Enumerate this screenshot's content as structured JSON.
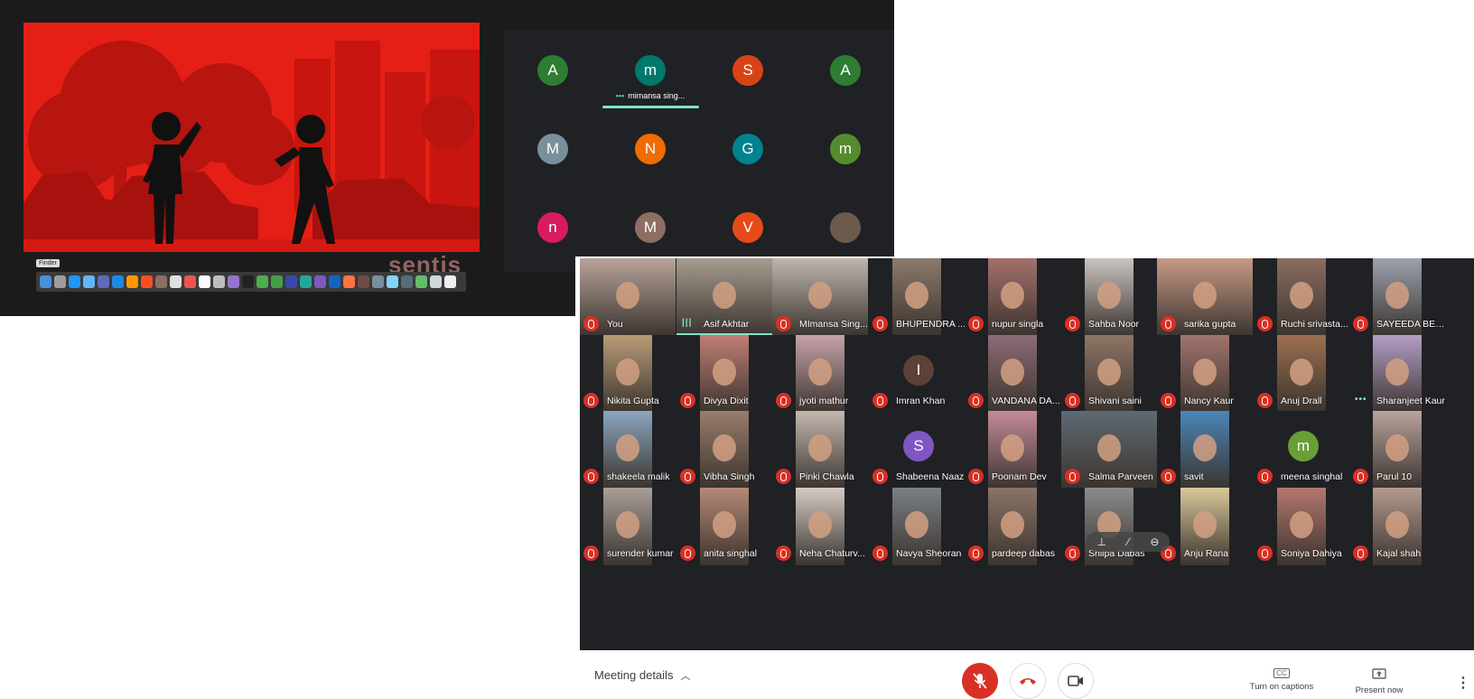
{
  "presentation": {
    "dock_tooltip": "Finder",
    "watermark": "sentis"
  },
  "top_grid": {
    "speaker_name": "mimansa sing...",
    "participants": [
      {
        "initial": "A",
        "color": "#2e7d32"
      },
      {
        "initial": "m",
        "color": "#00796b"
      },
      {
        "initial": "S",
        "color": "#d84315"
      },
      {
        "initial": "A",
        "color": "#2e7d32"
      },
      {
        "initial": "M",
        "color": "#78909c"
      },
      {
        "initial": "N",
        "color": "#ef6c00"
      },
      {
        "initial": "G",
        "color": "#00838f"
      },
      {
        "initial": "m",
        "color": "#558b2f"
      },
      {
        "initial": "n",
        "color": "#d81b60"
      },
      {
        "initial": "M",
        "color": "#8d6e63"
      },
      {
        "initial": "V",
        "color": "#e64a19"
      },
      {
        "initial": "",
        "color": "#6d5a4a",
        "photo": true
      }
    ]
  },
  "grid": {
    "tiles": [
      {
        "name": "You",
        "state": "muted",
        "photo_color": "#b8a49a"
      },
      {
        "name": "Asif Akhtar",
        "state": "speaking",
        "photo_color": "#a69c8f"
      },
      {
        "name": "MImansa Sing...",
        "state": "muted",
        "photo_color": "#bfb6ae"
      },
      {
        "name": "BHUPENDRA ...",
        "state": "muted",
        "photo_color": "#8b7a6c"
      },
      {
        "name": "nupur singla",
        "state": "muted",
        "photo_color": "#a4706c"
      },
      {
        "name": "Sahba Noor",
        "state": "muted",
        "photo_color": "#c9c4c0"
      },
      {
        "name": "sarika gupta",
        "state": "muted",
        "photo_color": "#c79a86"
      },
      {
        "name": "Ruchi srivasta...",
        "state": "muted",
        "photo_color": "#8a6d5f"
      },
      {
        "name": "SAYEEDA BEG...",
        "state": "muted",
        "photo_color": "#9ba1ae"
      },
      {
        "name": "Nikita Gupta",
        "state": "muted",
        "photo_color": "#b99c78"
      },
      {
        "name": "Divya Dixit",
        "state": "muted",
        "photo_color": "#c07f74"
      },
      {
        "name": "jyoti mathur",
        "state": "muted",
        "photo_color": "#c6a3a8"
      },
      {
        "name": "Imran Khan",
        "state": "muted",
        "avatar": "I",
        "avatar_color": "#5d4037"
      },
      {
        "name": "VANDANA DA...",
        "state": "muted",
        "photo_color": "#8d6b75"
      },
      {
        "name": "Shivani saini",
        "state": "muted",
        "photo_color": "#8e7566"
      },
      {
        "name": "Nancy Kaur",
        "state": "muted",
        "photo_color": "#a2746e"
      },
      {
        "name": "Anuj Drall",
        "state": "muted",
        "photo_color": "#9b6f4f"
      },
      {
        "name": "Sharanjeet Kaur",
        "state": "dots",
        "photo_color": "#b49ec7"
      },
      {
        "name": "shakeela malik",
        "state": "muted",
        "photo_color": "#8aa6bf"
      },
      {
        "name": "Vibha Singh",
        "state": "muted",
        "photo_color": "#9a7c6b"
      },
      {
        "name": "Pinki Chawla",
        "state": "muted",
        "photo_color": "#c3b8b0"
      },
      {
        "name": "Shabeena Naaz",
        "state": "muted",
        "avatar": "S",
        "avatar_color": "#7e57c2"
      },
      {
        "name": "Poonam Dev",
        "state": "muted",
        "photo_color": "#c48b98"
      },
      {
        "name": "Salma Parveen",
        "state": "muted",
        "photo_color": "#5f6a73"
      },
      {
        "name": "savit",
        "state": "muted",
        "photo_color": "#4a86b8"
      },
      {
        "name": "meena singhal",
        "state": "muted",
        "avatar": "m",
        "avatar_color": "#689f38"
      },
      {
        "name": "Parul 10",
        "state": "muted",
        "photo_color": "#b8a39d"
      },
      {
        "name": "surender kumar",
        "state": "muted",
        "photo_color": "#a99e98"
      },
      {
        "name": "anita singhal",
        "state": "muted",
        "photo_color": "#b58a76"
      },
      {
        "name": "Neha Chaturv...",
        "state": "muted",
        "photo_color": "#d6cbc4"
      },
      {
        "name": "Navya Sheoran",
        "state": "muted",
        "photo_color": "#7b7f84"
      },
      {
        "name": "pardeep dabas",
        "state": "muted",
        "photo_color": "#8a7466"
      },
      {
        "name": "Shilpa Dabas",
        "state": "muted",
        "photo_color": "#8c8c8c"
      },
      {
        "name": "Anju Rana",
        "state": "muted",
        "photo_color": "#d9c99a"
      },
      {
        "name": "Soniya Dahiya",
        "state": "muted",
        "photo_color": "#b4776e"
      },
      {
        "name": "Kajal shah",
        "state": "muted",
        "photo_color": "#b49a8f"
      }
    ]
  },
  "controls": {
    "meeting_details": "Meeting details",
    "captions_icon": "CC",
    "captions_label": "Turn on captions",
    "present_label": "Present now",
    "more_icon": "⋮",
    "hover_icons": [
      "pin-icon",
      "mute-icon",
      "remove-icon"
    ]
  }
}
